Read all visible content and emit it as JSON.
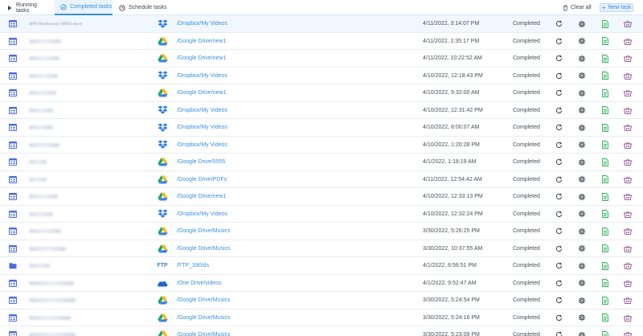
{
  "tabs": [
    {
      "label": "Running tasks",
      "icon": "play-icon"
    },
    {
      "label": "Completed tasks",
      "icon": "check-circle-icon"
    },
    {
      "label": "Schedule tasks",
      "icon": "clock-icon"
    }
  ],
  "toolbar": {
    "clear_label": "Clear all",
    "new_label": "New task"
  },
  "colors": {
    "accent": "#3d8fe0",
    "active_tab_bg": "#e9f3fd",
    "first_row_bg": "#f1f7fe"
  },
  "rows": [
    {
      "type": "task-list-icon",
      "name": "IPM Hathaway DB95.mod",
      "service": "dropbox",
      "path": "/Dropbox/My Videos",
      "date": "4/11/2022, 3:14:07 PM",
      "status": "Completed"
    },
    {
      "type": "task-list-icon",
      "name": "",
      "service": "google-drive",
      "path": "/Google Drive/new1",
      "date": "4/11/2022, 1:35:17 PM",
      "status": "Completed"
    },
    {
      "type": "task-list-icon",
      "name": "",
      "service": "google-drive",
      "path": "/Google Drive/new1",
      "date": "4/11/2022, 10:22:52 AM",
      "status": "Completed"
    },
    {
      "type": "task-list-icon",
      "name": "",
      "service": "dropbox",
      "path": "/Dropbox/My Videos",
      "date": "4/10/2022, 12:18:43 PM",
      "status": "Completed"
    },
    {
      "type": "task-list-icon",
      "name": "",
      "service": "google-drive",
      "path": "/Google Drive/new1",
      "date": "4/10/2022, 9:32:00 AM",
      "status": "Completed"
    },
    {
      "type": "task-list-icon",
      "name": "",
      "service": "dropbox",
      "path": "/Dropbox/My Videos",
      "date": "4/10/2022, 12:31:42 PM",
      "status": "Completed"
    },
    {
      "type": "task-list-icon",
      "name": "",
      "service": "dropbox",
      "path": "/Dropbox/My Videos",
      "date": "4/10/2022, 8:00:07 AM",
      "status": "Completed"
    },
    {
      "type": "task-list-icon",
      "name": "",
      "service": "dropbox",
      "path": "/Dropbox/My Videos",
      "date": "4/10/2022, 1:20:28 PM",
      "status": "Completed"
    },
    {
      "type": "task-list-icon",
      "name": "",
      "service": "google-drive",
      "path": "/Google Drive/5555",
      "date": "4/1/2022, 1:18:19 AM",
      "status": "Completed"
    },
    {
      "type": "task-list-icon",
      "name": "",
      "service": "google-drive",
      "path": "/Google Drive/PDFs",
      "date": "4/11/2022, 12:54:42 AM",
      "status": "Completed"
    },
    {
      "type": "task-list-icon",
      "name": "",
      "service": "google-drive",
      "path": "/Google Drive/new1",
      "date": "4/10/2022, 12:33:13 PM",
      "status": "Completed"
    },
    {
      "type": "task-list-icon",
      "name": "",
      "service": "dropbox",
      "path": "/Dropbox/My Videos",
      "date": "4/10/2022, 12:32:24 PM",
      "status": "Completed"
    },
    {
      "type": "task-list-icon",
      "name": "",
      "service": "google-drive",
      "path": "/Google Drive/Musics",
      "date": "3/30/2022, 5:26:25 PM",
      "status": "Completed"
    },
    {
      "type": "task-list-icon",
      "name": "",
      "service": "google-drive",
      "path": "/Google Drive/Musics",
      "date": "3/30/2022, 10:37:55 AM",
      "status": "Completed"
    },
    {
      "type": "folder-icon",
      "name": "",
      "service": "ftp",
      "service_label": "FTP",
      "path": "/FTP_390/ds",
      "date": "4/1/2022, 6:56:51 PM",
      "status": "Completed"
    },
    {
      "type": "task-list-icon",
      "name": "",
      "service": "onedrive",
      "path": "/One Drive/videos",
      "date": "4/1/2022, 9:52:47 AM",
      "status": "Completed"
    },
    {
      "type": "task-list-icon",
      "name": "",
      "service": "google-drive",
      "path": "/Google Drive/Musics",
      "date": "3/30/2022, 5:24:54 PM",
      "status": "Completed"
    },
    {
      "type": "task-list-icon",
      "name": "",
      "service": "google-drive",
      "path": "/Google Drive/Musics",
      "date": "3/30/2022, 5:24:16 PM",
      "status": "Completed"
    },
    {
      "type": "task-list-icon",
      "name": "",
      "service": "google-drive",
      "path": "/Google Drive/Musics",
      "date": "3/30/2022, 5:23:09 PM",
      "status": "Completed"
    }
  ],
  "row_actions": [
    "refresh-icon",
    "settings-gear-icon",
    "log-file-icon",
    "delete-basket-icon"
  ]
}
